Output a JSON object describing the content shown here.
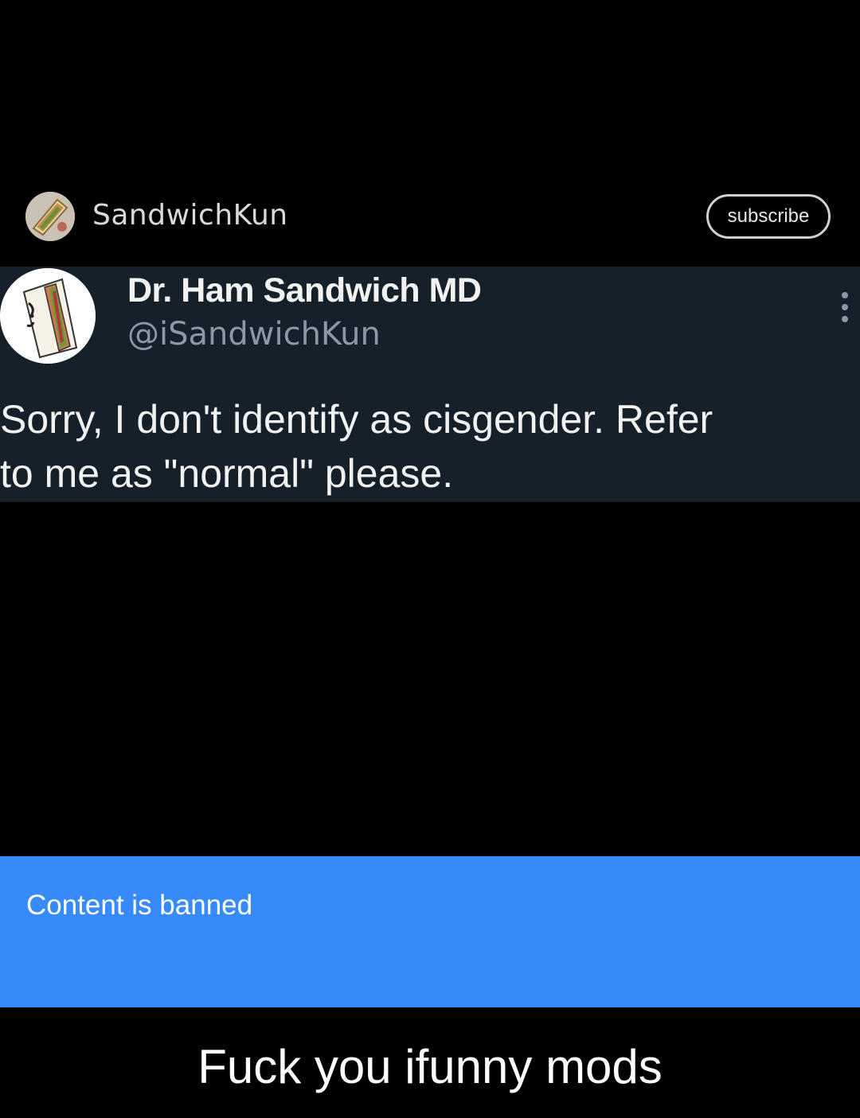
{
  "post": {
    "author_name": "SandwichKun",
    "author_avatar_icon": "sandwich-avatar-icon",
    "subscribe_label": "subscribe"
  },
  "tweet": {
    "display_name": "Dr. Ham Sandwich MD",
    "handle": "@iSandwichKun",
    "avatar_icon": "sandwich-drawing-avatar-icon",
    "more_icon": "vertical-ellipsis-icon",
    "text_lines": [
      "Sorry, I don't identify as cisgender. Refer",
      "to me as \"normal\" please."
    ],
    "background_color": "#15202b"
  },
  "banner": {
    "text": "Content is banned",
    "color": "#378afc"
  },
  "caption": "Fuck you ifunny mods"
}
